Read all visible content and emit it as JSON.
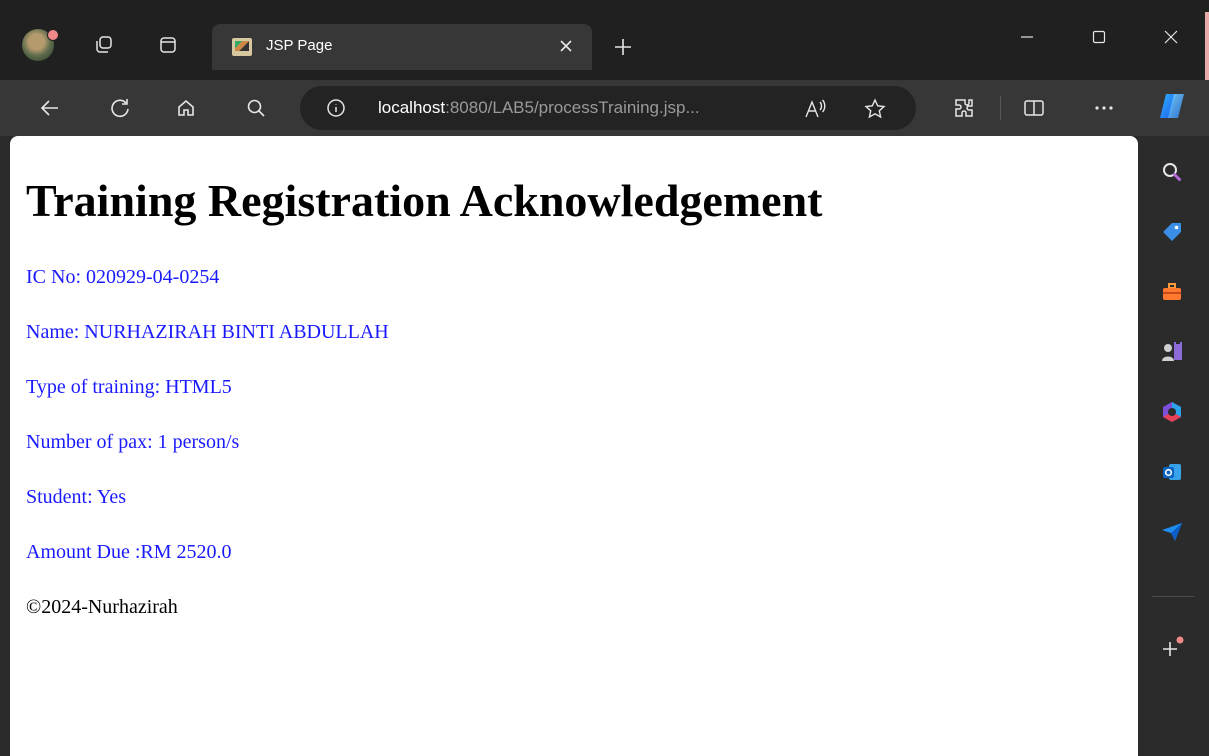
{
  "browser": {
    "tab": {
      "title": "JSP Page"
    },
    "address": {
      "host": "localhost",
      "rest": ":8080/LAB5/processTraining.jsp..."
    },
    "icons": {
      "workspaces": "workspaces-icon",
      "tab_actions": "tab-actions-icon",
      "back": "back-arrow-icon",
      "refresh": "refresh-icon",
      "home": "home-icon",
      "search": "search-icon",
      "info": "info-icon",
      "read_aloud": "read-aloud-icon",
      "favorite": "star-icon",
      "extensions": "extensions-icon",
      "split": "split-screen-icon",
      "more": "more-icon",
      "copilot": "copilot-icon"
    },
    "sidebar": [
      "search-icon",
      "tag-icon",
      "toolbox-icon",
      "games-icon",
      "office-icon",
      "outlook-icon",
      "send-icon",
      "add-icon"
    ],
    "colors": {
      "accent": "#1a1aff",
      "chrome": "#202020",
      "toolbar": "#373737"
    }
  },
  "page": {
    "heading": "Training Registration Acknowledgement",
    "lines": [
      "IC No: 020929-04-0254",
      "Name: NURHAZIRAH BINTI ABDULLAH",
      "Type of training: HTML5",
      "Number of pax: 1 person/s",
      "Student: Yes",
      "Amount Due :RM 2520.0"
    ],
    "footer": "©2024-Nurhazirah"
  }
}
